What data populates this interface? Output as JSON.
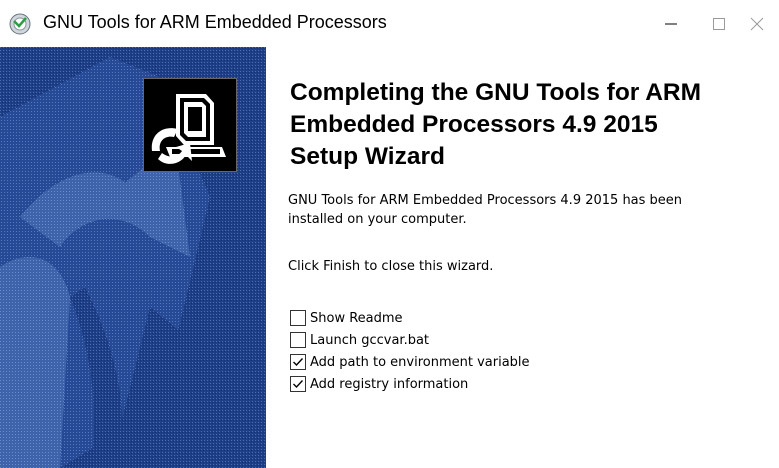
{
  "window": {
    "title": "GNU Tools for ARM Embedded Processors",
    "controls": {
      "minimize_icon": "minimize-icon",
      "maximize_icon": "maximize-icon",
      "close_icon": "close-icon"
    }
  },
  "wizard": {
    "heading_lines": [
      "Completing the GNU Tools for ARM",
      "Embedded Processors 4.9 2015",
      "Setup Wizard"
    ],
    "message_lines": [
      "GNU Tools for ARM Embedded Processors 4.9 2015 has been",
      "installed on your computer."
    ],
    "finish_hint": "Click Finish to close this wizard.",
    "options": [
      {
        "label": "Show Readme",
        "checked": false
      },
      {
        "label": "Launch gccvar.bat",
        "checked": false
      },
      {
        "label": "Add path to environment variable",
        "checked": true
      },
      {
        "label": "Add registry information",
        "checked": true
      }
    ]
  },
  "colors": {
    "side_panel": "#1e3e86",
    "side_panel_light": "#3a5ea8",
    "icon_bg": "#000000"
  },
  "icons": {
    "app": "installer-icon",
    "banner": "computer-install-icon"
  }
}
